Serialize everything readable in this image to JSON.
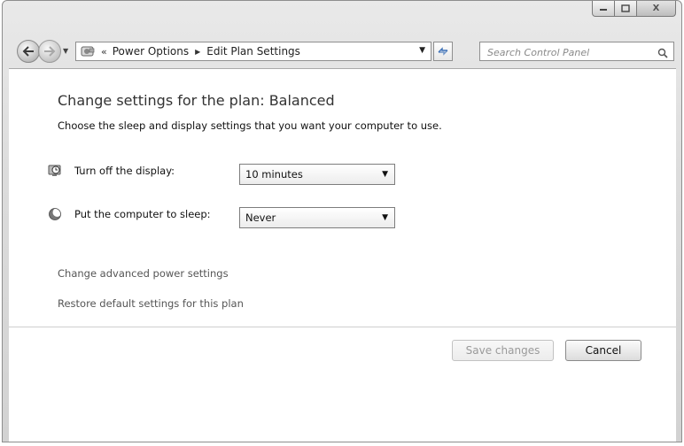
{
  "window": {
    "controls": {
      "minimize_icon": "minimize-icon",
      "maximize_icon": "maximize-icon",
      "close_glyph": "X"
    }
  },
  "navbar": {
    "back_icon": "back-arrow-icon",
    "forward_icon": "forward-arrow-icon",
    "overflow_glyph": "«",
    "breadcrumb": {
      "item1": "Power Options",
      "item2": "Edit Plan Settings"
    },
    "refresh_icon": "refresh-icon"
  },
  "search": {
    "placeholder": "Search Control Panel"
  },
  "main": {
    "title": "Change settings for the plan: Balanced",
    "subtitle": "Choose the sleep and display settings that you want your computer to use.",
    "settings": [
      {
        "label": "Turn off the display:",
        "value": "10 minutes",
        "icon": "display-timer-icon"
      },
      {
        "label": "Put the computer to sleep:",
        "value": "Never",
        "icon": "moon-icon"
      }
    ],
    "links": {
      "advanced": "Change advanced power settings",
      "restore": "Restore default settings for this plan"
    },
    "buttons": {
      "save": "Save changes",
      "cancel": "Cancel"
    }
  }
}
